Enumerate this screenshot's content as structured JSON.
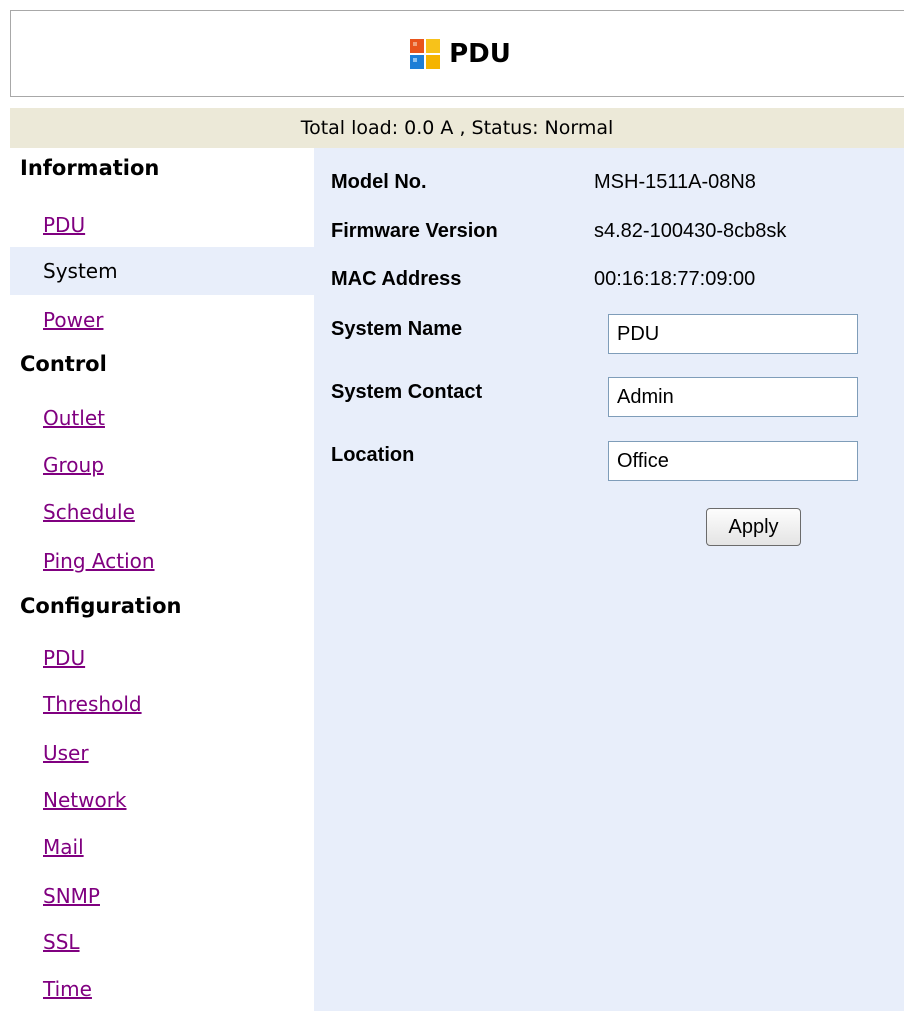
{
  "header": {
    "title": "PDU",
    "logo_icon": "windows-logo-icon"
  },
  "status": {
    "text": "Total load: 0.0 A , Status: Normal"
  },
  "sidebar": {
    "sections": [
      {
        "heading": "Information",
        "items": [
          "PDU",
          "System",
          "Power"
        ]
      },
      {
        "heading": "Control",
        "items": [
          "Outlet",
          "Group",
          "Schedule",
          "Ping Action"
        ]
      },
      {
        "heading": "Configuration",
        "items": [
          "PDU",
          "Threshold",
          "User",
          "Network",
          "Mail",
          "SNMP",
          "SSL",
          "Time"
        ]
      }
    ],
    "active_item": "System"
  },
  "info": {
    "model_label": "Model No.",
    "model_value": "MSH-1511A-08N8",
    "firmware_label": "Firmware Version",
    "firmware_value": "s4.82-100430-8cb8sk",
    "mac_label": "MAC Address",
    "mac_value": "00:16:18:77:09:00"
  },
  "form": {
    "system_name_label": "System Name",
    "system_name_value": "PDU",
    "system_contact_label": "System Contact",
    "system_contact_value": "Admin",
    "location_label": "Location",
    "location_value": "Office",
    "apply_label": "Apply"
  },
  "colors": {
    "status_bar_bg": "#ece9d8",
    "content_bg": "#e8eefa",
    "link_visited": "#800080"
  }
}
